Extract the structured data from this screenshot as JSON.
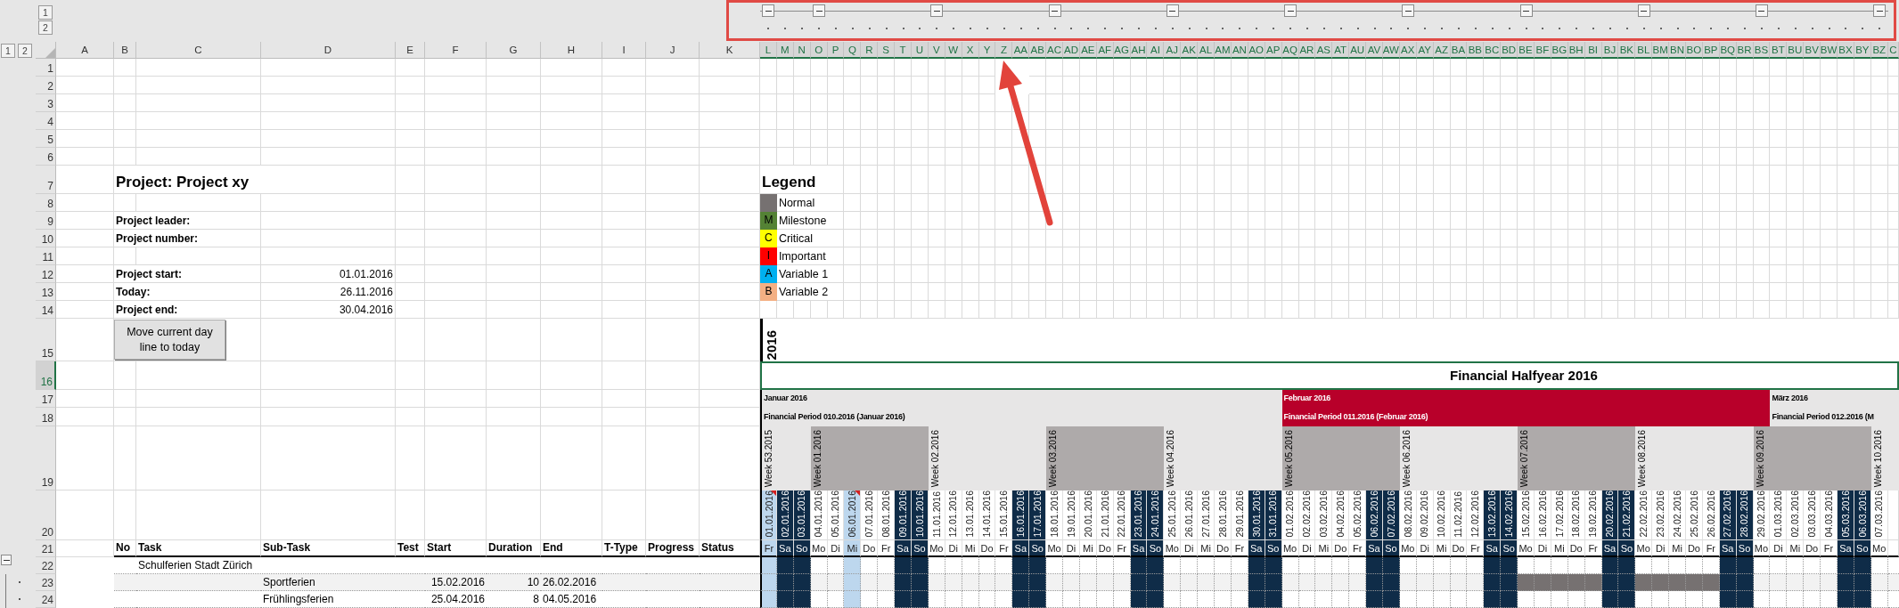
{
  "outline_levels": {
    "columns": [
      "1",
      "2"
    ],
    "rows": [
      "1",
      "2"
    ]
  },
  "column_headers": [
    {
      "label": "A",
      "selected": false
    },
    {
      "label": "B",
      "selected": false
    },
    {
      "label": "C",
      "selected": false
    },
    {
      "label": "D",
      "selected": false
    },
    {
      "label": "E",
      "selected": false
    },
    {
      "label": "F",
      "selected": false
    },
    {
      "label": "G",
      "selected": false
    },
    {
      "label": "H",
      "selected": false
    },
    {
      "label": "I",
      "selected": false
    },
    {
      "label": "J",
      "selected": false
    },
    {
      "label": "K",
      "selected": false
    },
    {
      "label": "L",
      "selected": true
    },
    {
      "label": "M",
      "selected": true
    },
    {
      "label": "N",
      "selected": true
    },
    {
      "label": "O",
      "selected": true
    },
    {
      "label": "P",
      "selected": true
    },
    {
      "label": "Q",
      "selected": true
    },
    {
      "label": "R",
      "selected": true
    },
    {
      "label": "S",
      "selected": true
    },
    {
      "label": "T",
      "selected": true
    },
    {
      "label": "U",
      "selected": true
    },
    {
      "label": "V",
      "selected": true
    },
    {
      "label": "W",
      "selected": true
    },
    {
      "label": "X",
      "selected": true
    },
    {
      "label": "Y",
      "selected": true
    },
    {
      "label": "Z",
      "selected": true
    },
    {
      "label": "AA",
      "selected": true
    },
    {
      "label": "AB",
      "selected": true
    },
    {
      "label": "AC",
      "selected": true
    },
    {
      "label": "AD",
      "selected": true
    },
    {
      "label": "AE",
      "selected": true
    },
    {
      "label": "AF",
      "selected": true
    },
    {
      "label": "AG",
      "selected": true
    },
    {
      "label": "AH",
      "selected": true
    },
    {
      "label": "AI",
      "selected": true
    },
    {
      "label": "AJ",
      "selected": true
    },
    {
      "label": "AK",
      "selected": true
    },
    {
      "label": "AL",
      "selected": true
    },
    {
      "label": "AM",
      "selected": true
    },
    {
      "label": "AN",
      "selected": true
    },
    {
      "label": "AO",
      "selected": true
    },
    {
      "label": "AP",
      "selected": true
    },
    {
      "label": "AQ",
      "selected": true
    },
    {
      "label": "AR",
      "selected": true
    },
    {
      "label": "AS",
      "selected": true
    },
    {
      "label": "AT",
      "selected": true
    },
    {
      "label": "AU",
      "selected": true
    },
    {
      "label": "AV",
      "selected": true
    },
    {
      "label": "AW",
      "selected": true
    },
    {
      "label": "AX",
      "selected": true
    },
    {
      "label": "AY",
      "selected": true
    },
    {
      "label": "AZ",
      "selected": true
    },
    {
      "label": "BA",
      "selected": true
    },
    {
      "label": "BB",
      "selected": true
    },
    {
      "label": "BC",
      "selected": true
    },
    {
      "label": "BD",
      "selected": true
    },
    {
      "label": "BE",
      "selected": true
    },
    {
      "label": "BF",
      "selected": true
    },
    {
      "label": "BG",
      "selected": true
    },
    {
      "label": "BH",
      "selected": true
    },
    {
      "label": "BI",
      "selected": true
    },
    {
      "label": "BJ",
      "selected": true
    },
    {
      "label": "BK",
      "selected": true
    },
    {
      "label": "BL",
      "selected": true
    },
    {
      "label": "BM",
      "selected": true
    },
    {
      "label": "BN",
      "selected": true
    },
    {
      "label": "BO",
      "selected": true
    },
    {
      "label": "BP",
      "selected": true
    },
    {
      "label": "BQ",
      "selected": true
    },
    {
      "label": "BR",
      "selected": true
    },
    {
      "label": "BS",
      "selected": true
    },
    {
      "label": "BT",
      "selected": true
    },
    {
      "label": "BU",
      "selected": true
    },
    {
      "label": "BV",
      "selected": true
    },
    {
      "label": "BW",
      "selected": true
    },
    {
      "label": "BX",
      "selected": true
    },
    {
      "label": "BY",
      "selected": true
    },
    {
      "label": "BZ",
      "selected": true
    },
    {
      "label": "C",
      "selected": true
    }
  ],
  "row_numbers": [
    {
      "label": "1",
      "selected": false
    },
    {
      "label": "2",
      "selected": false
    },
    {
      "label": "3",
      "selected": false
    },
    {
      "label": "4",
      "selected": false
    },
    {
      "label": "5",
      "selected": false
    },
    {
      "label": "6",
      "selected": false
    },
    {
      "label": "7",
      "selected": false
    },
    {
      "label": "8",
      "selected": false
    },
    {
      "label": "9",
      "selected": false
    },
    {
      "label": "10",
      "selected": false
    },
    {
      "label": "11",
      "selected": false
    },
    {
      "label": "12",
      "selected": false
    },
    {
      "label": "13",
      "selected": false
    },
    {
      "label": "14",
      "selected": false
    },
    {
      "label": "15",
      "selected": false
    },
    {
      "label": "16",
      "selected": true
    },
    {
      "label": "17",
      "selected": false
    },
    {
      "label": "18",
      "selected": false
    },
    {
      "label": "19",
      "selected": false
    },
    {
      "label": "20",
      "selected": false
    },
    {
      "label": "21",
      "selected": false
    },
    {
      "label": "22",
      "selected": false
    },
    {
      "label": "23",
      "selected": false
    },
    {
      "label": "24",
      "selected": false
    }
  ],
  "project": {
    "title": "Project: Project xy",
    "people": [
      {
        "label": "Project leader:"
      },
      {
        "label": "Project number:"
      }
    ],
    "dates": [
      {
        "label": "Project start:",
        "value": "01.01.2016"
      },
      {
        "label": "Today:",
        "value": "26.11.2016"
      },
      {
        "label": "Project end:",
        "value": "30.04.2016"
      }
    ],
    "button": "Move current day line to today"
  },
  "legend": {
    "title": "Legend",
    "items": [
      {
        "label": "Normal",
        "color": "#767171"
      },
      {
        "letter": "M",
        "label": "Milestone",
        "color": "#548235"
      },
      {
        "letter": "C",
        "label": "Critical",
        "color": "#ffff00"
      },
      {
        "letter": "I",
        "label": "Important",
        "color": "#ff0000"
      },
      {
        "letter": "A",
        "label": "Variable 1",
        "color": "#00b0f0"
      },
      {
        "letter": "B",
        "label": "Variable 2",
        "color": "#f4b084"
      }
    ]
  },
  "year": "2016",
  "halfyear": "Financial Halfyear 2016",
  "months": [
    {
      "name": "Januar 2016",
      "period": "Financial Period 010.2016 (Januar 2016)",
      "highlighted": false,
      "days": [
        {
          "date": "01.01.2016",
          "weekday": "Fr",
          "weekend": false,
          "holiday": true,
          "comment": true,
          "bar": false,
          "week": {
            "label": "Week 53.2015",
            "shaded": false,
            "expanded": true
          }
        },
        {
          "date": "02.01.2016",
          "weekday": "Sa",
          "weekend": true,
          "holiday": false,
          "comment": false,
          "bar": false
        },
        {
          "date": "03.01.2016",
          "weekday": "So",
          "weekend": true,
          "holiday": false,
          "comment": false,
          "bar": false
        },
        {
          "date": "04.01.2016",
          "weekday": "Mo",
          "weekend": false,
          "holiday": false,
          "comment": false,
          "bar": false,
          "week": {
            "label": "Week 01.2016",
            "shaded": true,
            "expanded": true
          }
        },
        {
          "date": "05.01.2016",
          "weekday": "Di",
          "weekend": false,
          "holiday": false,
          "comment": false,
          "bar": false
        },
        {
          "date": "06.01.2016",
          "weekday": "Mi",
          "weekend": false,
          "holiday": true,
          "comment": true,
          "bar": false
        },
        {
          "date": "07.01.2016",
          "weekday": "Do",
          "weekend": false,
          "holiday": false,
          "comment": false,
          "bar": false
        },
        {
          "date": "08.01.2016",
          "weekday": "Fr",
          "weekend": false,
          "holiday": false,
          "comment": false,
          "bar": false
        },
        {
          "date": "09.01.2016",
          "weekday": "Sa",
          "weekend": true,
          "holiday": false,
          "comment": false,
          "bar": false
        },
        {
          "date": "10.01.2016",
          "weekday": "So",
          "weekend": true,
          "holiday": false,
          "comment": false,
          "bar": false
        },
        {
          "date": "11.01.2016",
          "weekday": "Mo",
          "weekend": false,
          "holiday": false,
          "comment": false,
          "bar": false,
          "week": {
            "label": "Week 02.2016",
            "shaded": false,
            "expanded": true
          }
        },
        {
          "date": "12.01.2016",
          "weekday": "Di",
          "weekend": false,
          "holiday": false,
          "comment": false,
          "bar": false
        },
        {
          "date": "13.01.2016",
          "weekday": "Mi",
          "weekend": false,
          "holiday": false,
          "comment": false,
          "bar": false
        },
        {
          "date": "14.01.2016",
          "weekday": "Do",
          "weekend": false,
          "holiday": false,
          "comment": false,
          "bar": false
        },
        {
          "date": "15.01.2016",
          "weekday": "Fr",
          "weekend": false,
          "holiday": false,
          "comment": false,
          "bar": false
        },
        {
          "date": "16.01.2016",
          "weekday": "Sa",
          "weekend": true,
          "holiday": false,
          "comment": false,
          "bar": false
        },
        {
          "date": "17.01.2016",
          "weekday": "So",
          "weekend": true,
          "holiday": false,
          "comment": false,
          "bar": false
        },
        {
          "date": "18.01.2016",
          "weekday": "Mo",
          "weekend": false,
          "holiday": false,
          "comment": false,
          "bar": false,
          "week": {
            "label": "Week 03.2016",
            "shaded": true,
            "expanded": true
          }
        },
        {
          "date": "19.01.2016",
          "weekday": "Di",
          "weekend": false,
          "holiday": false,
          "comment": false,
          "bar": false
        },
        {
          "date": "20.01.2016",
          "weekday": "Mi",
          "weekend": false,
          "holiday": false,
          "comment": false,
          "bar": false
        },
        {
          "date": "21.01.2016",
          "weekday": "Do",
          "weekend": false,
          "holiday": false,
          "comment": false,
          "bar": false
        },
        {
          "date": "22.01.2016",
          "weekday": "Fr",
          "weekend": false,
          "holiday": false,
          "comment": false,
          "bar": false
        },
        {
          "date": "23.01.2016",
          "weekday": "Sa",
          "weekend": true,
          "holiday": false,
          "comment": false,
          "bar": false
        },
        {
          "date": "24.01.2016",
          "weekday": "So",
          "weekend": true,
          "holiday": false,
          "comment": false,
          "bar": false
        },
        {
          "date": "25.01.2016",
          "weekday": "Mo",
          "weekend": false,
          "holiday": false,
          "comment": false,
          "bar": false,
          "week": {
            "label": "Week 04.2016",
            "shaded": false,
            "expanded": true
          }
        },
        {
          "date": "26.01.2016",
          "weekday": "Di",
          "weekend": false,
          "holiday": false,
          "comment": false,
          "bar": false
        },
        {
          "date": "27.01.2016",
          "weekday": "Mi",
          "weekend": false,
          "holiday": false,
          "comment": false,
          "bar": false
        },
        {
          "date": "28.01.2016",
          "weekday": "Do",
          "weekend": false,
          "holiday": false,
          "comment": false,
          "bar": false
        },
        {
          "date": "29.01.2016",
          "weekday": "Fr",
          "weekend": false,
          "holiday": false,
          "comment": false,
          "bar": false
        },
        {
          "date": "30.01.2016",
          "weekday": "Sa",
          "weekend": true,
          "holiday": false,
          "comment": false,
          "bar": false
        },
        {
          "date": "31.01.2016",
          "weekday": "So",
          "weekend": true,
          "holiday": false,
          "comment": false,
          "bar": false
        }
      ]
    },
    {
      "name": "Februar 2016",
      "period": "Financial Period 011.2016 (Februar 2016)",
      "highlighted": true,
      "days": [
        {
          "date": "01.02.2016",
          "weekday": "Mo",
          "weekend": false,
          "holiday": false,
          "comment": false,
          "bar": false,
          "week": {
            "label": "Week 05.2016",
            "shaded": true,
            "expanded": true
          }
        },
        {
          "date": "02.02.2016",
          "weekday": "Di",
          "weekend": false,
          "holiday": false,
          "comment": false,
          "bar": false
        },
        {
          "date": "03.02.2016",
          "weekday": "Mi",
          "weekend": false,
          "holiday": false,
          "comment": false,
          "bar": false
        },
        {
          "date": "04.02.2016",
          "weekday": "Do",
          "weekend": false,
          "holiday": false,
          "comment": false,
          "bar": false
        },
        {
          "date": "05.02.2016",
          "weekday": "Fr",
          "weekend": false,
          "holiday": false,
          "comment": false,
          "bar": false
        },
        {
          "date": "06.02.2016",
          "weekday": "Sa",
          "weekend": true,
          "holiday": false,
          "comment": false,
          "bar": false
        },
        {
          "date": "07.02.2016",
          "weekday": "So",
          "weekend": true,
          "holiday": false,
          "comment": false,
          "bar": false
        },
        {
          "date": "08.02.2016",
          "weekday": "Mo",
          "weekend": false,
          "holiday": false,
          "comment": false,
          "bar": false,
          "week": {
            "label": "Week 06.2016",
            "shaded": false,
            "expanded": true
          }
        },
        {
          "date": "09.02.2016",
          "weekday": "Di",
          "weekend": false,
          "holiday": false,
          "comment": false,
          "bar": false
        },
        {
          "date": "10.02.2016",
          "weekday": "Mi",
          "weekend": false,
          "holiday": false,
          "comment": false,
          "bar": false
        },
        {
          "date": "11.02.2016",
          "weekday": "Do",
          "weekend": false,
          "holiday": false,
          "comment": false,
          "bar": false
        },
        {
          "date": "12.02.2016",
          "weekday": "Fr",
          "weekend": false,
          "holiday": false,
          "comment": false,
          "bar": false
        },
        {
          "date": "13.02.2016",
          "weekday": "Sa",
          "weekend": true,
          "holiday": false,
          "comment": false,
          "bar": false
        },
        {
          "date": "14.02.2016",
          "weekday": "So",
          "weekend": true,
          "holiday": false,
          "comment": false,
          "bar": false
        },
        {
          "date": "15.02.2016",
          "weekday": "Mo",
          "weekend": false,
          "holiday": false,
          "comment": false,
          "bar": true,
          "week": {
            "label": "Week 07.2016",
            "shaded": true,
            "expanded": true
          }
        },
        {
          "date": "16.02.2016",
          "weekday": "Di",
          "weekend": false,
          "holiday": false,
          "comment": false,
          "bar": true
        },
        {
          "date": "17.02.2016",
          "weekday": "Mi",
          "weekend": false,
          "holiday": false,
          "comment": false,
          "bar": true
        },
        {
          "date": "18.02.2016",
          "weekday": "Do",
          "weekend": false,
          "holiday": false,
          "comment": false,
          "bar": true
        },
        {
          "date": "19.02.2016",
          "weekday": "Fr",
          "weekend": false,
          "holiday": false,
          "comment": false,
          "bar": true
        },
        {
          "date": "20.02.2016",
          "weekday": "Sa",
          "weekend": true,
          "holiday": false,
          "comment": false,
          "bar": false
        },
        {
          "date": "21.02.2016",
          "weekday": "So",
          "weekend": true,
          "holiday": false,
          "comment": false,
          "bar": false
        },
        {
          "date": "22.02.2016",
          "weekday": "Mo",
          "weekend": false,
          "holiday": false,
          "comment": false,
          "bar": true,
          "week": {
            "label": "Week 08.2016",
            "shaded": false,
            "expanded": true
          }
        },
        {
          "date": "23.02.2016",
          "weekday": "Di",
          "weekend": false,
          "holiday": false,
          "comment": false,
          "bar": true
        },
        {
          "date": "24.02.2016",
          "weekday": "Mi",
          "weekend": false,
          "holiday": false,
          "comment": false,
          "bar": true
        },
        {
          "date": "25.02.2016",
          "weekday": "Do",
          "weekend": false,
          "holiday": false,
          "comment": false,
          "bar": true
        },
        {
          "date": "26.02.2016",
          "weekday": "Fr",
          "weekend": false,
          "holiday": false,
          "comment": false,
          "bar": true
        },
        {
          "date": "27.02.2016",
          "weekday": "Sa",
          "weekend": true,
          "holiday": false,
          "comment": false,
          "bar": false
        },
        {
          "date": "28.02.2016",
          "weekday": "So",
          "weekend": true,
          "holiday": false,
          "comment": false,
          "bar": false
        },
        {
          "date": "29.02.2016",
          "weekday": "Mo",
          "weekend": false,
          "holiday": false,
          "comment": false,
          "bar": false,
          "week": {
            "label": "Week 09.2016",
            "shaded": true,
            "expanded": true
          }
        }
      ]
    },
    {
      "name": "März 2016",
      "period": "Financial Period 012.2016 (M",
      "highlighted": false,
      "days": [
        {
          "date": "01.03.2016",
          "weekday": "Di",
          "weekend": false,
          "holiday": false,
          "comment": false,
          "bar": false
        },
        {
          "date": "02.03.2016",
          "weekday": "Mi",
          "weekend": false,
          "holiday": false,
          "comment": false,
          "bar": false
        },
        {
          "date": "03.03.2016",
          "weekday": "Do",
          "weekend": false,
          "holiday": false,
          "comment": false,
          "bar": false
        },
        {
          "date": "04.03.2016",
          "weekday": "Fr",
          "weekend": false,
          "holiday": false,
          "comment": false,
          "bar": false
        },
        {
          "date": "05.03.2016",
          "weekday": "Sa",
          "weekend": true,
          "holiday": false,
          "comment": false,
          "bar": false
        },
        {
          "date": "06.03.2016",
          "weekday": "So",
          "weekend": true,
          "holiday": false,
          "comment": false,
          "bar": false
        },
        {
          "date": "07.03.2016",
          "weekday": "Mo",
          "weekend": false,
          "holiday": false,
          "comment": false,
          "bar": false,
          "week": {
            "label": "Week 10.2016",
            "shaded": false,
            "expanded": true
          }
        }
      ]
    }
  ],
  "table": {
    "headers": [
      "No",
      "Task",
      "Sub-Task",
      "Test",
      "Start",
      "Duration",
      "End",
      "T-Type",
      "Progress",
      "Status"
    ]
  },
  "tasks": [
    {
      "kind": "group",
      "task": "Schulferien Stadt Zürich",
      "expanded": true,
      "shaded": false,
      "bar": false
    },
    {
      "kind": "subtask",
      "subtask": "Sportferien",
      "start": "15.02.2016",
      "duration": "10",
      "end": "26.02.2016",
      "shaded": true,
      "bar": true
    },
    {
      "kind": "subtask",
      "subtask": "Frühlingsferien",
      "start": "25.04.2016",
      "duration": "8",
      "end": "04.05.2016",
      "shaded": false,
      "bar": false
    }
  ]
}
